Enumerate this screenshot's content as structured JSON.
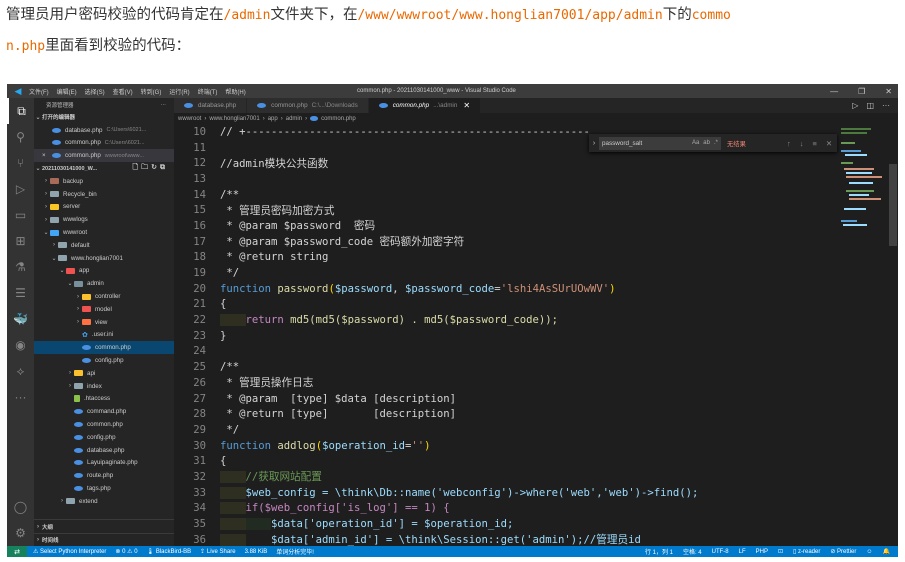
{
  "article": {
    "line1_prefix": "管理员用户密码校验的代码肯定在",
    "code1": "/admin",
    "line1_mid": "文件夹下，在",
    "code2": "/www/wwwroot/www.honglian7001/app/admin",
    "line1_mid2": "下的",
    "code3a": "commo",
    "code3b": "n.php",
    "line2_suffix": "里面看到校验的代码："
  },
  "window": {
    "title": "common.php - 20211030141000_www - Visual Studio Code",
    "menu": [
      "文件(F)",
      "编辑(E)",
      "选择(S)",
      "查看(V)",
      "转到(G)",
      "运行(R)",
      "终端(T)",
      "帮助(H)"
    ],
    "controls": {
      "minimize": "—",
      "restore": "❐",
      "close": "✕"
    }
  },
  "activity_bar": [
    "explorer-icon",
    "search-icon",
    "source-control-icon",
    "run-debug-icon",
    "remote-explorer-icon",
    "extensions-icon",
    "testing-icon",
    "outline-list-icon",
    "docker-icon",
    "tabnine-icon",
    "gitlens-icon",
    "more-icon"
  ],
  "sidebar": {
    "header": "资源管理器",
    "header_more": "···",
    "open_editors_label": "打开的编辑器",
    "open_editors": [
      {
        "name": "database.php",
        "path": "C:\\Users\\6021..."
      },
      {
        "name": "common.php",
        "path": "C:\\Users\\6021..."
      },
      {
        "name": "common.php",
        "path": "wwwroot\\www..."
      }
    ],
    "workspace_label": "20211030141000_W...",
    "tree": [
      {
        "label": "backup"
      },
      {
        "label": "Recycle_bin"
      },
      {
        "label": "server"
      },
      {
        "label": "wwwlogs"
      },
      {
        "label": "wwwroot"
      },
      {
        "label": "default"
      },
      {
        "label": "www.honglian7001"
      },
      {
        "label": "app"
      },
      {
        "label": "admin"
      },
      {
        "label": "controller"
      },
      {
        "label": "model"
      },
      {
        "label": "view"
      },
      {
        "label": ".user.ini"
      },
      {
        "label": "common.php"
      },
      {
        "label": "config.php"
      },
      {
        "label": "api"
      },
      {
        "label": "index"
      },
      {
        "label": ".htaccess"
      },
      {
        "label": "command.php"
      },
      {
        "label": "common.php"
      },
      {
        "label": "config.php"
      },
      {
        "label": "database.php"
      },
      {
        "label": "Layuipaginate.php"
      },
      {
        "label": "route.php"
      },
      {
        "label": "tags.php"
      },
      {
        "label": "extend"
      }
    ],
    "outline_label": "大纲",
    "timeline_label": "时间线"
  },
  "tabs": [
    {
      "name": "database.php",
      "path": ""
    },
    {
      "name": "common.php",
      "path": "C:\\...\\Downloads"
    },
    {
      "name": "common.php",
      "path": "...\\admin",
      "active": true
    }
  ],
  "breadcrumb": [
    "wwwroot",
    "www.honglian7001",
    "app",
    "admin",
    "common.php"
  ],
  "find": {
    "query": "password_salt",
    "case_label": "Aa",
    "word_label": "ab",
    "regex_label": ".*",
    "result": "无结果"
  },
  "code": {
    "line_numbers": [
      10,
      11,
      12,
      13,
      14,
      15,
      16,
      17,
      18,
      19,
      20,
      21,
      22,
      23,
      24,
      25,
      26,
      27,
      28,
      29,
      30,
      31,
      32,
      33,
      34,
      35,
      36
    ],
    "comment_line10": "// +------------------------------------------------------",
    "comment_line12": "//admin模块公共函数",
    "doc1": [
      "/**",
      " * 管理员密码加密方式",
      " * @param $password  密码",
      " * @param $password_code 密码额外加密字符",
      " * @return string",
      " */"
    ],
    "fn1_name": "password",
    "fn1_param1": "$password",
    "fn1_param2": "$password_code",
    "fn1_default": "'lshi4AsSUrUOwWV'",
    "fn1_body": "md5(md5($password) . md5($password_code));",
    "doc2": [
      "/**",
      " * 管理员操作日志",
      " * @param  [type] $data [description]",
      " * @return [type]       [description]",
      " */"
    ],
    "fn2_name": "addlog",
    "fn2_param": "$operation_id",
    "line32": "//获取网站配置",
    "line33": "$web_config = \\think\\Db::name('webconfig')->where('web','web')->find();",
    "line34": "if($web_config['is_log'] == 1) {",
    "line35": "$data['operation_id'] = $operation_id;",
    "line36": "$data['admin_id'] = \\think\\Session::get('admin');//管理员id"
  },
  "status": {
    "python": "Select Python Interpreter",
    "errors": "0",
    "warnings": "0",
    "blackbird": "BlackBird-BB",
    "liveshare": "Live Share",
    "size": "3.88 KiB",
    "word_count": "单词分析完毕!",
    "cursor": "行 1，列 1",
    "spaces": "空格: 4",
    "encoding": "UTF-8",
    "eol": "LF",
    "language": "PHP",
    "reader": "z-reader",
    "prettier": "Prettier"
  }
}
